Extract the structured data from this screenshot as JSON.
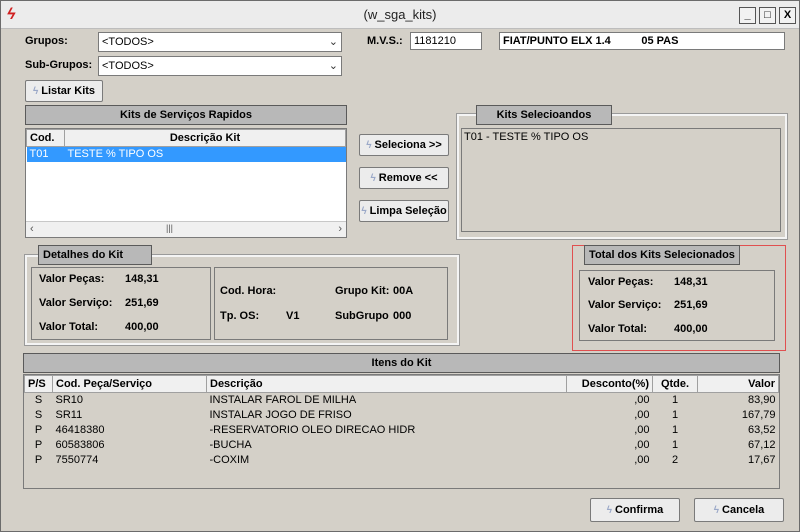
{
  "window": {
    "title": "(w_sga_kits)",
    "min": "_",
    "max": "□",
    "close": "X"
  },
  "filters": {
    "grupos_label": "Grupos:",
    "grupos_value": "<TODOS>",
    "subgrupos_label": "Sub-Grupos:",
    "subgrupos_value": "<TODOS>",
    "mvs_label": "M.V.S.:",
    "mvs_value": "1181210",
    "vehicle": "FIAT/PUNTO ELX 1.4          05 PAS"
  },
  "buttons": {
    "listar": "Listar Kits",
    "seleciona": "Seleciona >>",
    "remove": "Remove <<",
    "limpa": "Limpa Seleção",
    "confirma": "Confirma",
    "cancela": "Cancela"
  },
  "kits_rapidos": {
    "title": "Kits de Serviços Rapidos",
    "col_cod": "Cod.",
    "col_desc": "Descrição Kit",
    "rows": [
      {
        "cod": "T01",
        "desc": "TESTE % TIPO OS"
      }
    ]
  },
  "kits_selecionados": {
    "title": "Kits Selecioandos",
    "items": [
      "T01 - TESTE % TIPO OS"
    ]
  },
  "detalhes": {
    "title": "Detalhes do Kit",
    "valor_pecas_label": "Valor Peças:",
    "valor_pecas": "148,31",
    "valor_servico_label": "Valor Serviço:",
    "valor_servico": "251,69",
    "valor_total_label": "Valor Total:",
    "valor_total": "400,00",
    "cod_hora_label": "Cod. Hora:",
    "cod_hora": "",
    "grupo_kit_label": "Grupo Kit:",
    "grupo_kit": "00A",
    "tp_os_label": "Tp. OS:",
    "tp_os": "V1",
    "subgrupo_label": "SubGrupo",
    "subgrupo": "000"
  },
  "totais": {
    "title": "Total dos Kits Selecionados",
    "valor_pecas_label": "Valor Peças:",
    "valor_pecas": "148,31",
    "valor_servico_label": "Valor Serviço:",
    "valor_servico": "251,69",
    "valor_total_label": "Valor Total:",
    "valor_total": "400,00"
  },
  "itens": {
    "title": "Itens do Kit",
    "headers": {
      "ps": "P/S",
      "cod": "Cod. Peça/Serviço",
      "desc": "Descrição",
      "desconto": "Desconto(%)",
      "qtde": "Qtde.",
      "valor": "Valor"
    },
    "rows": [
      {
        "ps": "S",
        "cod": "SR10",
        "desc": "INSTALAR FAROL DE MILHA",
        "desconto": ",00",
        "qtde": "1",
        "valor": "83,90"
      },
      {
        "ps": "S",
        "cod": "SR11",
        "desc": "INSTALAR JOGO DE FRISO",
        "desconto": ",00",
        "qtde": "1",
        "valor": "167,79"
      },
      {
        "ps": "P",
        "cod": "46418380",
        "desc": "-RESERVATORIO OLEO DIRECAO HIDR",
        "desconto": ",00",
        "qtde": "1",
        "valor": "63,52"
      },
      {
        "ps": "P",
        "cod": "60583806",
        "desc": "-BUCHA",
        "desconto": ",00",
        "qtde": "1",
        "valor": "67,12"
      },
      {
        "ps": "P",
        "cod": "7550774",
        "desc": "-COXIM",
        "desconto": ",00",
        "qtde": "2",
        "valor": "17,67"
      }
    ]
  },
  "colors": {
    "selection": "#3399ff",
    "highlight_border": "#e05050",
    "header_bg": "#b8b8b8"
  }
}
